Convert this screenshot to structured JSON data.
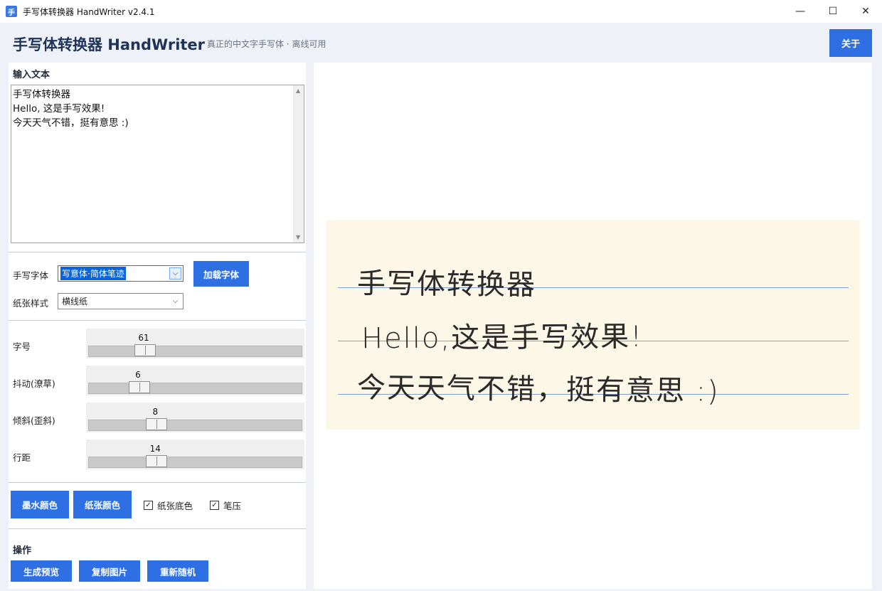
{
  "window": {
    "icon_char": "手",
    "title": "手写体转换器 HandWriter v2.4.1",
    "minimize": "—",
    "maximize": "☐",
    "close": "✕"
  },
  "header": {
    "title": "手写体转换器 HandWriter",
    "subtitle": "真正的中文字手写体 · 离线可用",
    "about_label": "关于"
  },
  "input": {
    "label": "输入文本",
    "text": "手写体转换器\nHello, 这是手写效果!\n今天天气不错，挺有意思 :)"
  },
  "font": {
    "label": "手写字体",
    "selected": "写意体·简体笔迹",
    "load_label": "加载字体"
  },
  "paper_style": {
    "label": "纸张样式",
    "selected": "横线纸"
  },
  "sliders": [
    {
      "label": "字号",
      "value": "61",
      "fraction": 0.24
    },
    {
      "label": "抖动(潦草)",
      "value": "6",
      "fraction": 0.21
    },
    {
      "label": "倾斜(歪斜)",
      "value": "8",
      "fraction": 0.3
    },
    {
      "label": "行距",
      "value": "14",
      "fraction": 0.3
    }
  ],
  "colors": {
    "ink_label": "墨水颜色",
    "paper_label": "纸张颜色",
    "paper_bg_label": "纸张底色",
    "paper_bg_checked": true,
    "pressure_label": "笔压",
    "pressure_checked": true
  },
  "actions": {
    "label": "操作",
    "generate_label": "生成预览",
    "copy_label": "复制图片",
    "rerandom_label": "重新随机"
  },
  "preview": {
    "lines": [
      "手写体转换器",
      "Hello,这是手写效果!",
      "今天天气不错，挺有意思 :)"
    ]
  },
  "theme": {
    "accent": "#2f6fe4",
    "paper": "#fdf7e7",
    "rule_line": "#7f9fd3"
  }
}
